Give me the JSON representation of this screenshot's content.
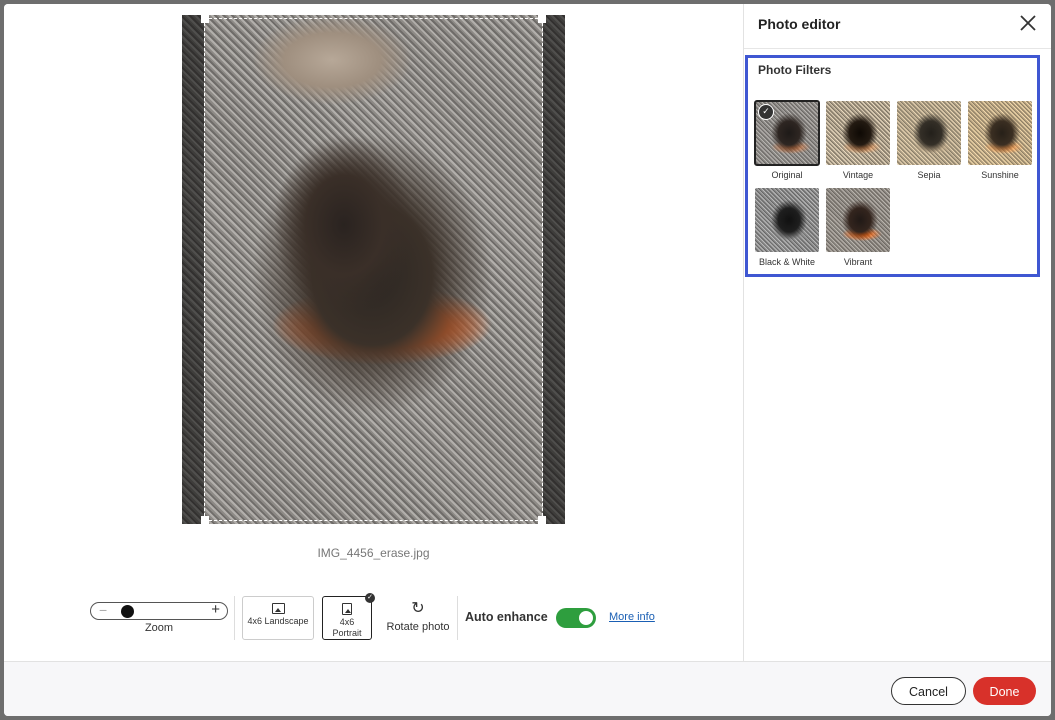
{
  "editor": {
    "title": "Photo editor",
    "filename": "IMG_4456_erase.jpg"
  },
  "filters": {
    "title": "Photo Filters",
    "selected": "Original",
    "items": [
      {
        "label": "Original"
      },
      {
        "label": "Vintage"
      },
      {
        "label": "Sepia"
      },
      {
        "label": "Sunshine"
      },
      {
        "label": "Black & White"
      },
      {
        "label": "Vibrant"
      }
    ]
  },
  "toolbar": {
    "zoom_label": "Zoom",
    "zoom_minus": "−",
    "zoom_plus": "+",
    "landscape_label": "4x6 Landscape",
    "portrait_label": "4x6 Portrait",
    "selected_format": "4x6 Portrait",
    "rotate_label": "Rotate photo",
    "auto_enhance_label": "Auto enhance",
    "auto_enhance_on": true,
    "more_info_label": "More info"
  },
  "footer": {
    "cancel_label": "Cancel",
    "done_label": "Done"
  },
  "colors": {
    "accent": "#3f57d2",
    "done": "#d8312a",
    "toggle_on": "#2e9e3e",
    "link": "#1a5fb4"
  },
  "icons": {
    "close": "close-icon",
    "rotate": "rotate-icon",
    "landscape": "landscape-image-icon",
    "portrait": "portrait-image-icon",
    "check": "check-icon"
  }
}
